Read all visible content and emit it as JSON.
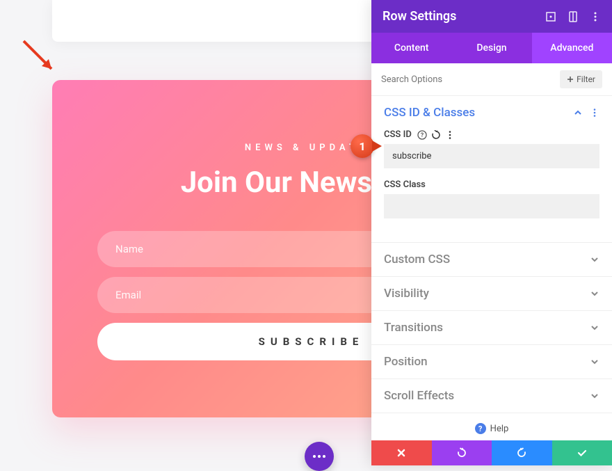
{
  "newsletter": {
    "subtitle": "NEWS & UPDATES",
    "title": "Join Our Newsletter",
    "name_placeholder": "Name",
    "email_placeholder": "Email",
    "submit_label": "SUBSCRIBE"
  },
  "panel": {
    "title": "Row Settings",
    "tabs": {
      "content": "Content",
      "design": "Design",
      "advanced": "Advanced"
    },
    "search_placeholder": "Search Options",
    "filter_label": "Filter",
    "sections": {
      "css_id_classes": {
        "title": "CSS ID & Classes",
        "css_id_label": "CSS ID",
        "css_id_value": "subscribe",
        "css_class_label": "CSS Class",
        "css_class_value": ""
      },
      "custom_css": "Custom CSS",
      "visibility": "Visibility",
      "transitions": "Transitions",
      "position": "Position",
      "scroll_effects": "Scroll Effects"
    },
    "help_label": "Help"
  },
  "callout_1": "1"
}
